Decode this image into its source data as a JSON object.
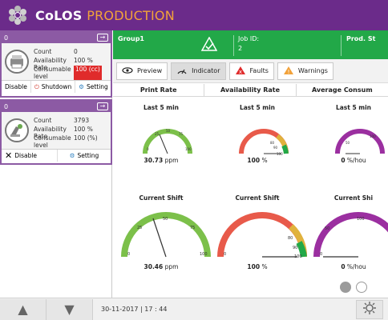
{
  "app": {
    "brand_prefix": "CoLOS",
    "brand_suffix": "PRODUCTION"
  },
  "left_panel": {
    "units": [
      {
        "header_id": "0",
        "rows": [
          {
            "key": "Count",
            "value": "0"
          },
          {
            "key": "Availability Rate",
            "value": "100 %"
          },
          {
            "key": "Consumable level",
            "value": "100 (cc)"
          }
        ],
        "actions": [
          "Disable",
          "Shutdown",
          "Setting"
        ]
      },
      {
        "header_id": "0",
        "rows": [
          {
            "key": "Count",
            "value": "3793"
          },
          {
            "key": "Availability Rate",
            "value": "100 %"
          },
          {
            "key": "Consumable level",
            "value": "100 (%)"
          }
        ],
        "actions": [
          "Disable",
          "Setting"
        ]
      }
    ]
  },
  "main": {
    "status": {
      "group": "Group1",
      "job_label": "Job ID:",
      "job_value": "2",
      "prod_label": "Prod. St"
    },
    "tabs": {
      "preview": "Preview",
      "indicator": "Indicator",
      "faults": "Faults",
      "warnings": "Warnings"
    },
    "columns": [
      "Print Rate",
      "Availability Rate",
      "Average Consum"
    ],
    "small_gauges": [
      {
        "title": "Last 5 min",
        "value": "30.73",
        "unit": "ppm",
        "ticks": [
          "0",
          "25",
          "50",
          "75",
          "100"
        ]
      },
      {
        "title": "Last 5 min",
        "value": "100",
        "unit": "%",
        "ticks": [
          "80",
          "90",
          "100"
        ]
      },
      {
        "title": "Last 5 min",
        "value": "0",
        "unit": "%/hou",
        "ticks": [
          "50",
          "100"
        ]
      }
    ],
    "large_gauges": [
      {
        "title": "Current Shift",
        "value": "30.46",
        "unit": "ppm",
        "ticks": [
          "0",
          "25",
          "50",
          "75",
          "100"
        ]
      },
      {
        "title": "Current Shift",
        "value": "100",
        "unit": "%",
        "ticks": [
          "0",
          "80",
          "90",
          "100"
        ]
      },
      {
        "title": "Current Shi",
        "value": "0",
        "unit": "%/hou",
        "ticks": [
          "0",
          "50",
          "100"
        ]
      }
    ]
  },
  "footer": {
    "datetime": "30-11-2017  |  17 : 44"
  },
  "colors": {
    "brand_purple": "#6b2b8a",
    "green": "#22a848",
    "orange": "#f2a23a"
  }
}
